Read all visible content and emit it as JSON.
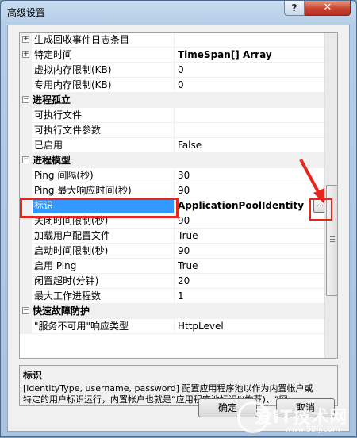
{
  "window": {
    "title": "高级设置",
    "help_label": "?",
    "close_label": "✕"
  },
  "grid": {
    "rows": [
      {
        "type": "prop",
        "expander": "+",
        "name": "生成回收事件日志条目",
        "value": ""
      },
      {
        "type": "prop",
        "expander": "+",
        "name": "特定时间",
        "value": "TimeSpan[] Array",
        "bold": true
      },
      {
        "type": "prop",
        "name": "虚拟内存限制(KB)",
        "value": "0"
      },
      {
        "type": "prop",
        "name": "专用内存限制(KB)",
        "value": "0"
      },
      {
        "type": "cat",
        "expander": "−",
        "name": "进程孤立"
      },
      {
        "type": "prop",
        "name": "可执行文件",
        "value": ""
      },
      {
        "type": "prop",
        "name": "可执行文件参数",
        "value": ""
      },
      {
        "type": "prop",
        "name": "已启用",
        "value": "False"
      },
      {
        "type": "cat",
        "expander": "−",
        "name": "进程模型"
      },
      {
        "type": "prop",
        "name": "Ping 间隔(秒)",
        "value": "30"
      },
      {
        "type": "prop",
        "name": "Ping 最大响应时间(秒)",
        "value": "90"
      },
      {
        "type": "selected",
        "name": "标识",
        "value": "ApplicationPoolIdentity",
        "button": "..."
      },
      {
        "type": "prop",
        "name": "关闭时间限制(秒)",
        "value": "90"
      },
      {
        "type": "prop",
        "name": "加载用户配置文件",
        "value": "True"
      },
      {
        "type": "prop",
        "name": "启动时间限制(秒)",
        "value": "90"
      },
      {
        "type": "prop",
        "name": "启用 Ping",
        "value": "True"
      },
      {
        "type": "prop",
        "name": "闲置超时(分钟)",
        "value": "20"
      },
      {
        "type": "prop",
        "name": "最大工作进程数",
        "value": "1"
      },
      {
        "type": "cat",
        "expander": "−",
        "name": "快速故障防护"
      },
      {
        "type": "prop",
        "name": "\"服务不可用\"响应类型",
        "value": "HttpLevel"
      }
    ]
  },
  "description": {
    "title": "标识",
    "line1": "[identityType, username, password] 配置应用程序池以作为内置帐户或",
    "line2": "特定的用户标识运行，内置帐户也就是“应用程序池标识”(推荐)、“网..."
  },
  "buttons": {
    "ok": "确定",
    "cancel": "取消"
  },
  "watermark": {
    "text": "爱IT技术网",
    "url": "www.52ij.com"
  },
  "colors": {
    "annotation": "#e8251c",
    "selection": "#3399ff"
  }
}
